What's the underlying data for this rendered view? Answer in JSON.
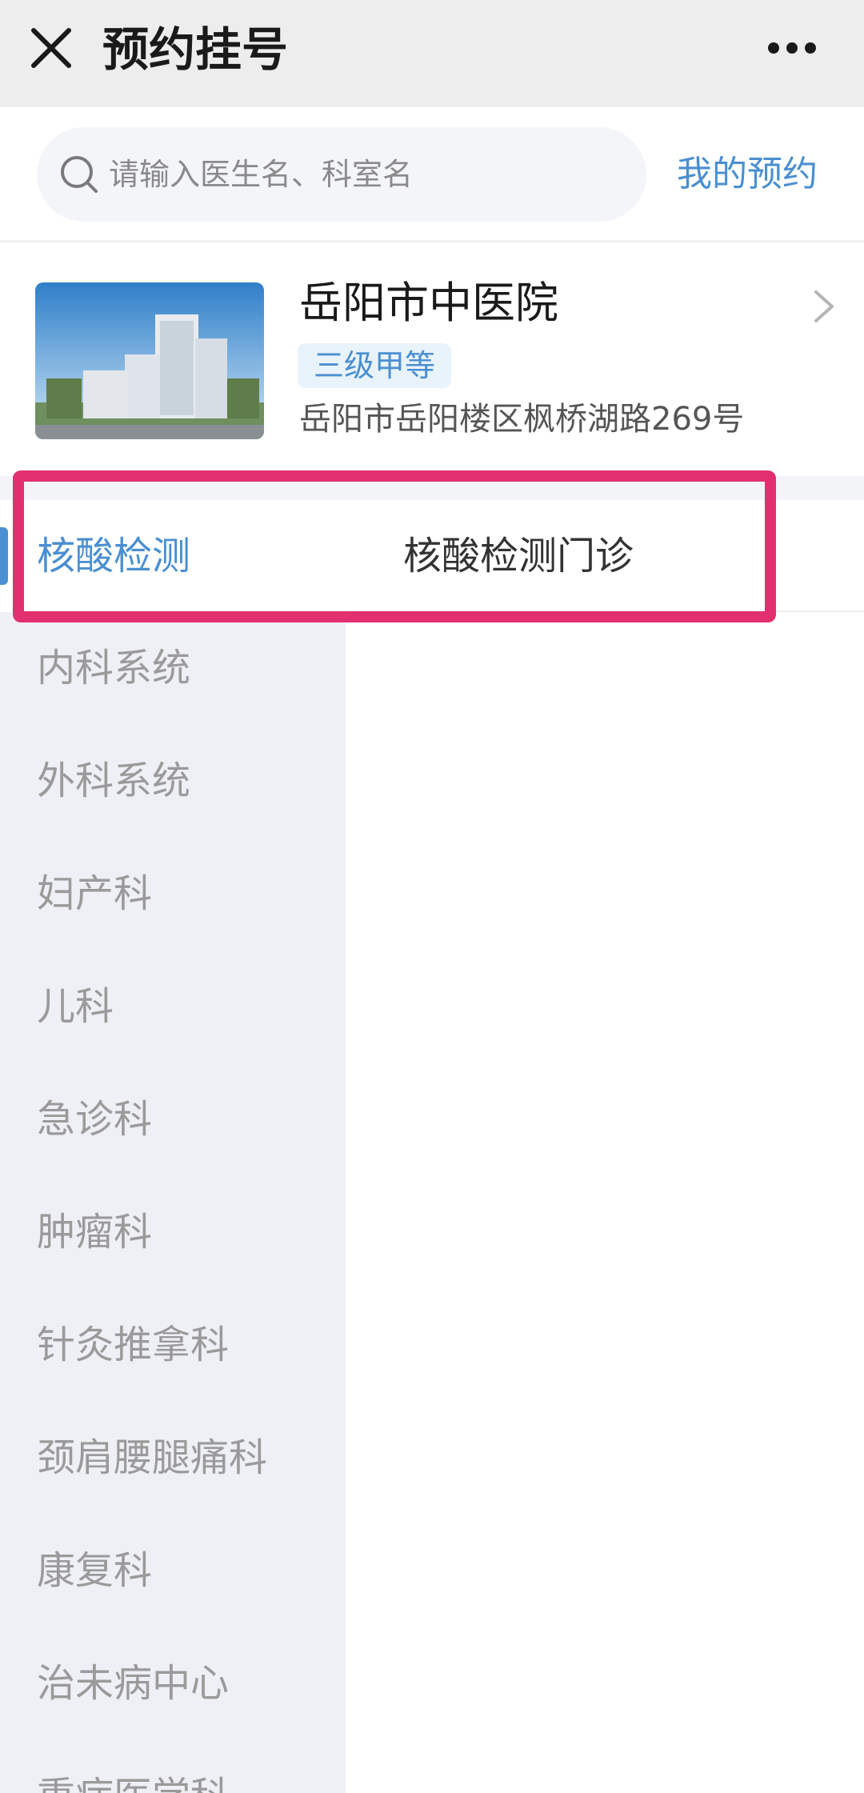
{
  "header": {
    "title": "预约挂号",
    "close_icon": "close-icon",
    "more_icon": "more-horizontal-icon"
  },
  "search": {
    "placeholder": "请输入医生名、科室名",
    "icon": "search-icon",
    "my_appointments_label": "我的预约"
  },
  "hospital": {
    "name": "岳阳市中医院",
    "grade": "三级甲等",
    "address": "岳阳市岳阳楼区枫桥湖路269号",
    "image": "hospital-building-photo",
    "chevron_icon": "chevron-right-icon"
  },
  "departments": {
    "active_index": 0,
    "items": [
      {
        "label": "核酸检测"
      },
      {
        "label": "内科系统"
      },
      {
        "label": "外科系统"
      },
      {
        "label": "妇产科"
      },
      {
        "label": "儿科"
      },
      {
        "label": "急诊科"
      },
      {
        "label": "肿瘤科"
      },
      {
        "label": "针灸推拿科"
      },
      {
        "label": "颈肩腰腿痛科"
      },
      {
        "label": "康复科"
      },
      {
        "label": "治未病中心"
      },
      {
        "label": "重症医学科"
      }
    ]
  },
  "clinics": {
    "items": [
      {
        "label": "核酸检测门诊"
      }
    ]
  },
  "colors": {
    "accent": "#4a8fd1",
    "highlight": "#e2306f",
    "sidebar_bg": "#eef0f5",
    "topbar_bg": "#ededed"
  }
}
